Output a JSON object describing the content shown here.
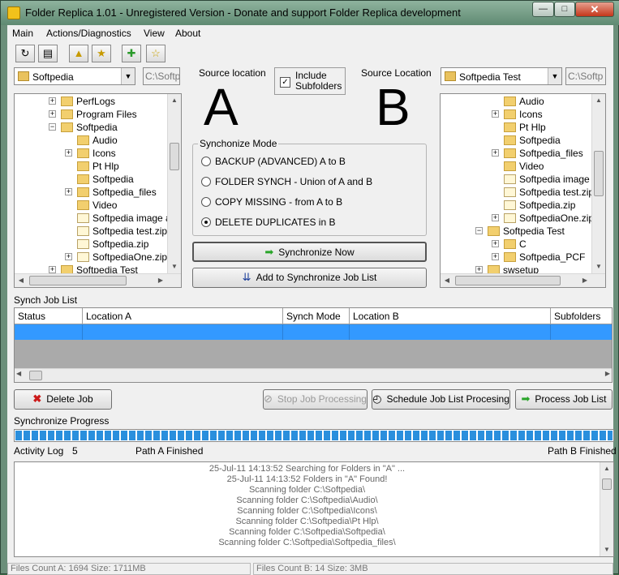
{
  "window": {
    "title": "Folder Replica 1.01 - Unregistered Version - Donate and support Folder Replica development",
    "min_glyph": "—",
    "max_glyph": "□",
    "close_glyph": "✕"
  },
  "menu": [
    "Main",
    "Actions/Diagnostics",
    "View",
    "About"
  ],
  "toolbar": {
    "icons": [
      "clock-refresh-icon",
      "document-icon",
      "folder-up-icon",
      "folder-star-icon",
      "add-star-icon",
      "star-icon"
    ],
    "glyphs": [
      "↻",
      "▤",
      "▲",
      "★",
      "✚",
      "☆"
    ]
  },
  "left": {
    "drive": "Softpedia",
    "path": "C:\\Softp",
    "tree": [
      {
        "label": "PerfLogs",
        "expander": "+",
        "indent": 1,
        "type": "folder"
      },
      {
        "label": "Program Files",
        "expander": "+",
        "indent": 1,
        "type": "folder"
      },
      {
        "label": "Softpedia",
        "expander": "−",
        "indent": 1,
        "type": "folder"
      },
      {
        "label": "Audio",
        "expander": "",
        "indent": 2,
        "type": "folder"
      },
      {
        "label": "Icons",
        "expander": "+",
        "indent": 2,
        "type": "folder"
      },
      {
        "label": "Pt Hlp",
        "expander": "",
        "indent": 2,
        "type": "folder"
      },
      {
        "label": "Softpedia",
        "expander": "",
        "indent": 2,
        "type": "folder"
      },
      {
        "label": "Softpedia_files",
        "expander": "+",
        "indent": 2,
        "type": "folder"
      },
      {
        "label": "Video",
        "expander": "",
        "indent": 2,
        "type": "folder"
      },
      {
        "label": "Softpedia image ar",
        "expander": "",
        "indent": 2,
        "type": "file"
      },
      {
        "label": "Softpedia test.zip",
        "expander": "",
        "indent": 2,
        "type": "file"
      },
      {
        "label": "Softpedia.zip",
        "expander": "",
        "indent": 2,
        "type": "file"
      },
      {
        "label": "SoftpediaOne.zip",
        "expander": "+",
        "indent": 2,
        "type": "file"
      },
      {
        "label": "Softpedia Test",
        "expander": "+",
        "indent": 1,
        "type": "folder"
      }
    ]
  },
  "right": {
    "drive": "Softpedia Test",
    "path": "C:\\Softp",
    "tree": [
      {
        "label": "Audio",
        "expander": "",
        "indent": 2,
        "type": "folder"
      },
      {
        "label": "Icons",
        "expander": "+",
        "indent": 2,
        "type": "folder"
      },
      {
        "label": "Pt Hlp",
        "expander": "",
        "indent": 2,
        "type": "folder"
      },
      {
        "label": "Softpedia",
        "expander": "",
        "indent": 2,
        "type": "folder"
      },
      {
        "label": "Softpedia_files",
        "expander": "+",
        "indent": 2,
        "type": "folder"
      },
      {
        "label": "Video",
        "expander": "",
        "indent": 2,
        "type": "folder"
      },
      {
        "label": "Softpedia image ar",
        "expander": "",
        "indent": 2,
        "type": "file"
      },
      {
        "label": "Softpedia test.zip",
        "expander": "",
        "indent": 2,
        "type": "file"
      },
      {
        "label": "Softpedia.zip",
        "expander": "",
        "indent": 2,
        "type": "file"
      },
      {
        "label": "SoftpediaOne.zip",
        "expander": "+",
        "indent": 2,
        "type": "file"
      },
      {
        "label": "Softpedia Test",
        "expander": "−",
        "indent": 1,
        "type": "folder"
      },
      {
        "label": "C",
        "expander": "+",
        "indent": 2,
        "type": "folder"
      },
      {
        "label": "Softpedia_PCF",
        "expander": "+",
        "indent": 2,
        "type": "folder"
      },
      {
        "label": "swsetup",
        "expander": "+",
        "indent": 1,
        "type": "folder"
      }
    ]
  },
  "center": {
    "source_label_a": "Source location",
    "source_label_b": "Source Location",
    "letter_a": "A",
    "letter_b": "B",
    "include_subfolders": "Include\nSubfolders",
    "include_checked": "✓",
    "synch_mode_legend": "Synchonize Mode",
    "modes": [
      {
        "label": "BACKUP (ADVANCED) A to B",
        "selected": false
      },
      {
        "label": "FOLDER SYNCH - Union of A and B",
        "selected": false
      },
      {
        "label": "COPY MISSING - from A to B",
        "selected": false
      },
      {
        "label": "DELETE DUPLICATES in B",
        "selected": true
      }
    ],
    "sync_now": "Synchronize Now",
    "add_to_list": "Add to Synchronize Job List"
  },
  "job_list": {
    "title": "Synch Job List",
    "columns": [
      "Status",
      "Location A",
      "Synch Mode",
      "Location B",
      "Subfolders"
    ]
  },
  "actions": {
    "delete_job": "Delete Job",
    "stop_processing": "Stop Job Processing",
    "schedule": "Schedule Job List Procesing",
    "process": "Process Job List"
  },
  "progress": {
    "label": "Synchronize Progress",
    "fraction": 1.0
  },
  "activity": {
    "label": "Activity Log",
    "count": "5",
    "path_a": "Path A Finished",
    "path_b": "Path B Finished",
    "lines": [
      "25-Jul-11 14:13:52 Searching for Folders in \"A\" ...",
      "25-Jul-11 14:13:52 Folders in \"A\" Found!",
      "Scanning folder C:\\Softpedia\\",
      "Scanning folder C:\\Softpedia\\Audio\\",
      "Scanning folder C:\\Softpedia\\Icons\\",
      "Scanning folder C:\\Softpedia\\Pt Hlp\\",
      "Scanning folder C:\\Softpedia\\Softpedia\\",
      "Scanning folder C:\\Softpedia\\Softpedia_files\\"
    ]
  },
  "status": {
    "files_a": "Files Count A: 1694  Size: 1711MB",
    "files_b": "Files Count B: 14  Size: 3MB"
  },
  "colors": {
    "selection": "#3399ff",
    "progress": "#2a8fdd",
    "close_button": "#c5361a"
  }
}
